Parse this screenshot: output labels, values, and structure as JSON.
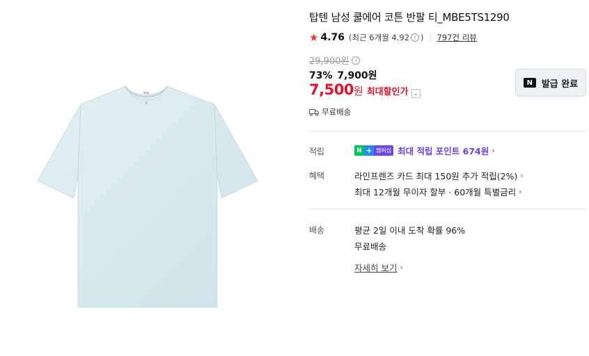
{
  "product": {
    "title": "탑텐 남성 쿨에어 코튼 반팔 티_MBE5TS1290",
    "image_alt": "light blue crew neck t-shirt"
  },
  "rating": {
    "score": "4.76",
    "recent_prefix": "(최근 6개월 4.92",
    "recent_suffix": ")",
    "review_count": "797건 리뷰"
  },
  "price": {
    "original": "29,900원",
    "discount_percent": "73%",
    "sale": "7,900원",
    "max_discount_value": "7,500",
    "max_discount_unit": "원",
    "max_discount_label": "최대할인가"
  },
  "coupon": {
    "label": "발급 완료",
    "logo": "N"
  },
  "shipping_summary": "무료배송",
  "sections": {
    "points": {
      "label": "적립",
      "badge_n": "N",
      "badge_plus": "+",
      "badge_text": "멤버십",
      "text": "최대 적립 포인트 674원"
    },
    "benefits": {
      "label": "혜택",
      "line1": "라인프렌즈 카드 최대 150원 추가 적립(2%)",
      "line2": "최대 12개월 무이자 할부 · 60개월 특별금리"
    },
    "delivery": {
      "label": "배송",
      "line1": "평균 2일 이내 도착 확률 96%",
      "line2": "무료배송",
      "detail_link": "자세히 보기"
    }
  },
  "colors": {
    "accent_red": "#e5142b",
    "star_red": "#f0342f",
    "naver_green": "#03c75a",
    "point_purple": "#6a3ff0",
    "shirt": "#d9ebef"
  }
}
